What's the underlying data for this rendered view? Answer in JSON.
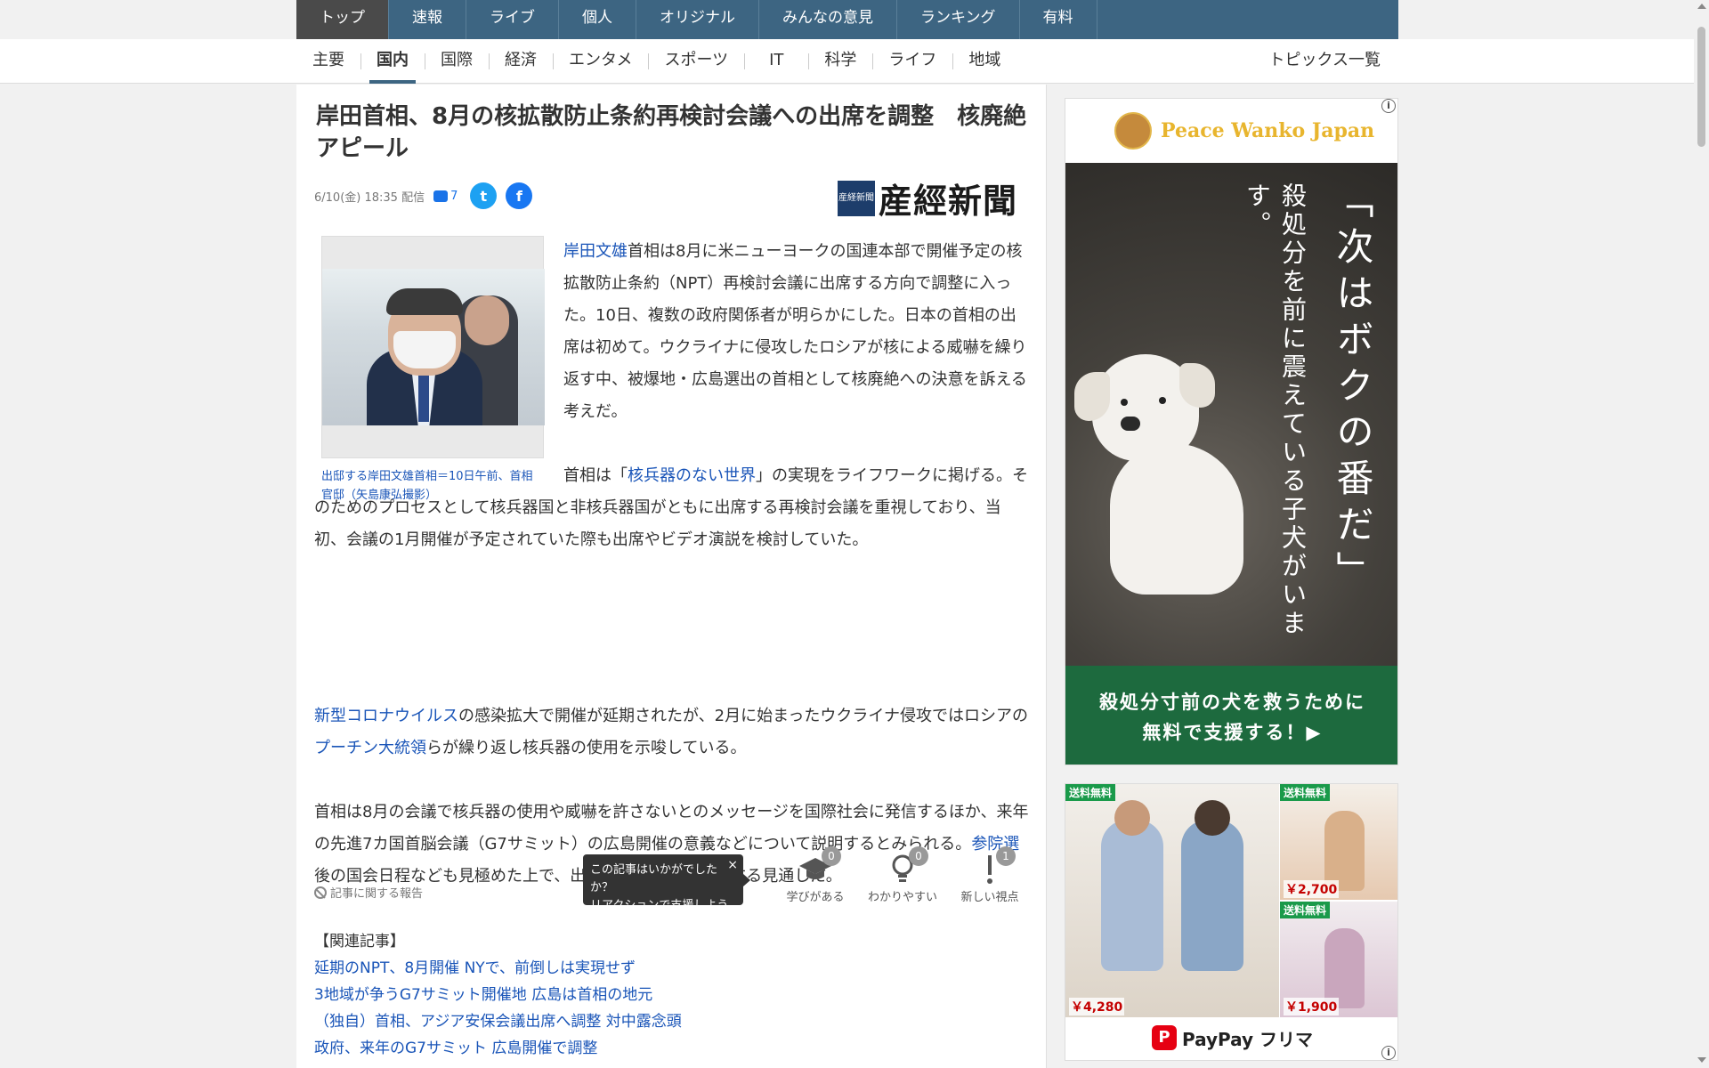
{
  "topnav": [
    "トップ",
    "速報",
    "ライブ",
    "個人",
    "オリジナル",
    "みんなの意見",
    "ランキング",
    "有料"
  ],
  "subnav": {
    "categories": [
      "主要",
      "国内",
      "国際",
      "経済",
      "エンタメ",
      "スポーツ",
      "IT",
      "科学",
      "ライフ",
      "地域"
    ],
    "active": "国内",
    "topics": "トピックス一覧"
  },
  "article": {
    "headline": "岸田首相、8月の核拡散防止条約再検討会議への出席を調整　核廃絶アピール",
    "date": "6/10(金) 18:35 配信",
    "comment_count": "7",
    "publisher_seal": "産経新聞",
    "publisher": "産經新聞",
    "photo_caption": "出邸する岸田文雄首相＝10日午前、首相官邸（矢島康弘撮影）",
    "p1_link": "岸田文雄",
    "p1_rest": "首相は8月に米ニューヨークの国連本部で開催予定の核拡散防止条約（NPT）再検討会議に出席する方向で調整に入った。10日、複数の政府関係者が明らかにした。日本の首相の出席は初めて。ウクライナに侵攻したロシアが核による威嚇を繰り返す中、被爆地・広島選出の首相として核廃絶への決意を訴える考えだ。",
    "p2_pre": "首相は「",
    "p2_link": "核兵器のない世界",
    "p2_post": "」の実現をライフワークに掲げる。そのためのプロセスとして核兵器国と非核兵器国がともに出席する再検討会議を重視しており、当初、会議の1月開催が予定されていた際も出席やビデオ演説を検討していた。",
    "p3_link1": "新型コロナウイルス",
    "p3_mid": "の感染拡大で開催が延期されたが、2月に始まったウクライナ侵攻ではロシアの",
    "p3_link2": "プーチン大統領",
    "p3_post": "らが繰り返し核兵器の使用を示唆している。",
    "p4_pre": "首相は8月の会議で核兵器の使用や威嚇を許さないとのメッセージを国際社会に発信するほか、来年の先進7カ国首脳会議（G7サミット）の広島開催の意義などについて説明するとみられる。",
    "p4_link": "参院選",
    "p4_post": "後の国会日程なども見極めた上で、出席の可否を最終判断する見通しだ。"
  },
  "report_label": "記事に関する報告",
  "tooltip": {
    "line1": "この記事はいかがでしたか？",
    "line2": "リアクションで支援しよう",
    "close": "×"
  },
  "reactions": [
    {
      "label": "学びがある",
      "count": "0",
      "icon": "graduation-cap-icon"
    },
    {
      "label": "わかりやすい",
      "count": "0",
      "icon": "lightbulb-icon"
    },
    {
      "label": "新しい視点",
      "count": "1",
      "icon": "exclamation-icon"
    }
  ],
  "related": {
    "heading": "【関連記事】",
    "items": [
      "延期のNPT、8月開催 NYで、前倒しは実現せず",
      "3地域が争うG7サミット開催地 広島は首相の地元",
      "（独自）首相、アジア安保会議出席へ調整 対中露念頭",
      "政府、来年のG7サミット 広島開催で調整"
    ]
  },
  "ad1": {
    "brand": "Peace Wanko Japan",
    "headline": "「次はボクの番だ」",
    "sub": "殺処分を前に震えている子犬がいます。",
    "cta_line1": "殺処分寸前の犬を救うために",
    "cta_line2": "無料で支援する！▶"
  },
  "ad2": {
    "badge": "送料無料",
    "prices": [
      "￥4,280",
      "￥2,700",
      "￥1,900"
    ],
    "brand": "PayPay フリマ"
  }
}
